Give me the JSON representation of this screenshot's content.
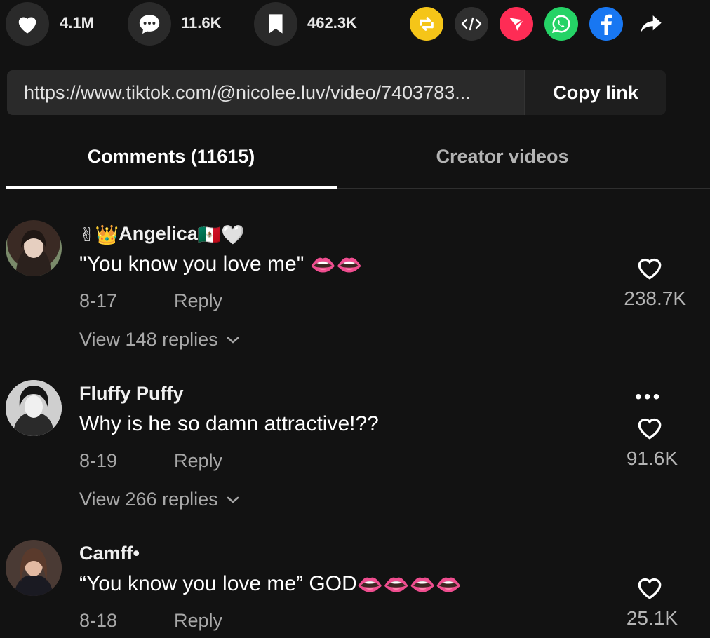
{
  "actions": {
    "likes": "4.1M",
    "comments": "11.6K",
    "saves": "462.3K",
    "share_targets": [
      "repost-icon",
      "embed-icon",
      "send-icon",
      "whatsapp-icon",
      "facebook-icon",
      "share-arrow-icon"
    ],
    "colors": {
      "repost": "#f5c518",
      "embed": "#2f2f2f",
      "send": "#fe2c55",
      "whatsapp": "#25d366",
      "facebook": "#1877f2"
    }
  },
  "url_bar": {
    "url": "https://www.tiktok.com/@nicolee.luv/video/7403783...",
    "copy_label": "Copy link"
  },
  "tabs": [
    {
      "label": "Comments (11615)",
      "active": true
    },
    {
      "label": "Creator videos",
      "active": false
    }
  ],
  "comments": [
    {
      "username": "Angelica",
      "username_emoji_prefix": "✌👑",
      "username_emoji_suffix": "🇲🇽🤍",
      "text": "\"You know you love me\"",
      "text_emoji": "👄👄",
      "date": "8-17",
      "reply_label": "Reply",
      "likes": "238.7K",
      "view_replies": "View 148 replies"
    },
    {
      "username": "Fluffy Puffy",
      "text": "Why is he so damn attractive!??",
      "date": "8-19",
      "reply_label": "Reply",
      "likes": "91.6K",
      "view_replies": "View 266 replies",
      "more": "•••"
    },
    {
      "username": "Camff•",
      "text": "“You know you love me” GOD",
      "text_emoji": "👄👄👄👄",
      "date": "8-18",
      "reply_label": "Reply",
      "likes": "25.1K"
    }
  ]
}
